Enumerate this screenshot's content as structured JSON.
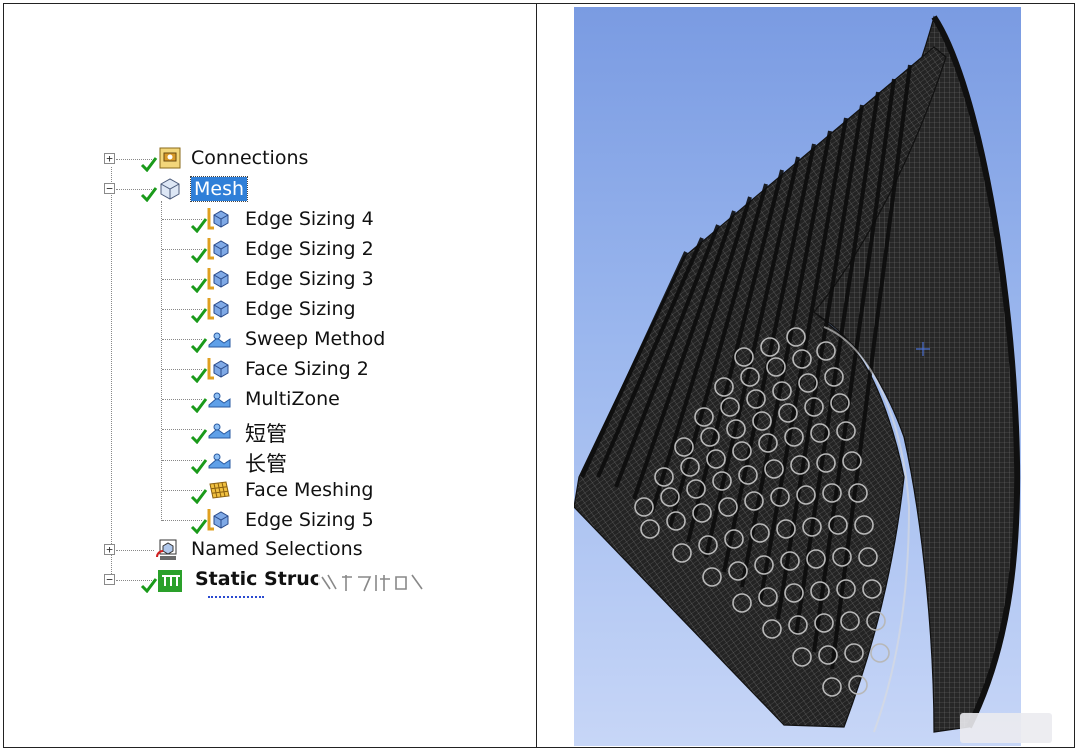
{
  "tree": {
    "nodes": [
      {
        "label": "Connections",
        "icon": "connections-icon"
      },
      {
        "label": "Mesh",
        "icon": "mesh-icon"
      },
      {
        "label": "Edge Sizing 4",
        "icon": "edge-sizing-icon"
      },
      {
        "label": "Edge Sizing 2",
        "icon": "edge-sizing-icon"
      },
      {
        "label": "Edge Sizing 3",
        "icon": "edge-sizing-icon"
      },
      {
        "label": "Edge Sizing",
        "icon": "edge-sizing-icon"
      },
      {
        "label": "Sweep Method",
        "icon": "method-icon"
      },
      {
        "label": "Face Sizing 2",
        "icon": "face-sizing-icon"
      },
      {
        "label": "MultiZone",
        "icon": "method-icon"
      },
      {
        "label": "短管",
        "icon": "method-icon"
      },
      {
        "label": "长管",
        "icon": "method-icon"
      },
      {
        "label": "Face Meshing",
        "icon": "face-meshing-icon"
      },
      {
        "label": "Edge Sizing 5",
        "icon": "edge-sizing-icon"
      },
      {
        "label": "Named Selections",
        "icon": "named-selections-icon"
      },
      {
        "label": "Static Struc",
        "icon": "static-structural-icon"
      }
    ],
    "expanders": {
      "connections": "+",
      "mesh": "−",
      "named_selections": "+",
      "static_structural": "−"
    },
    "selected": "Mesh"
  },
  "viewport": {
    "background_top": "#7a9be2",
    "background_bottom": "#c7d6f7",
    "mesh_color": "#1a1a1a",
    "marker_color": "#4a6fd0",
    "model": "meshed-tube-bundle"
  },
  "colors": {
    "selection": "#2f7fd8",
    "check": "#1a9a1a"
  }
}
